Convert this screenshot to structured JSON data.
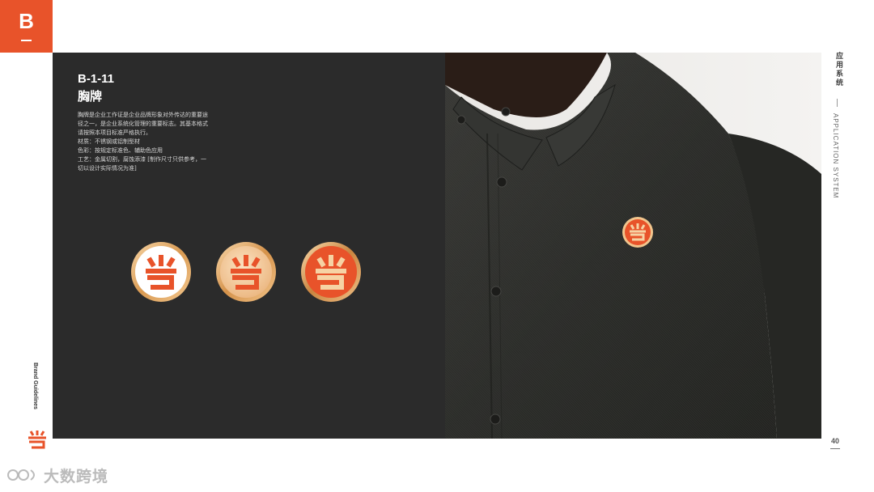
{
  "section": {
    "letter": "B"
  },
  "content": {
    "code": "B-1-11",
    "title": "胸牌",
    "description": [
      "胸牌是企业工作证是企业品牌形象对外传达的重要途径之一，是企业系统化管理的重要标志。其基本格式请按照本项目标准严格执行。",
      "材质：不锈钢或铝制型材",
      "色彩：按规定标准色、辅助色应用",
      "工艺：金属切割，腐蚀添漆 [制作尺寸只供参考，一切以设计实际情况为准]"
    ]
  },
  "badges": [
    {
      "variant": "white-face",
      "glyph": "sun-logo"
    },
    {
      "variant": "light-gold-face",
      "glyph": "sun-logo"
    },
    {
      "variant": "gold-face",
      "glyph": "sun-logo"
    }
  ],
  "side": {
    "category_cn": "应用系统",
    "category_en": "APPLICATION SYSTEM",
    "brand_guidelines": "Brand Guidelines"
  },
  "page_number": "40",
  "watermark": {
    "text": "大数跨境"
  },
  "colors": {
    "brand_orange": "#e8532a",
    "panel_dark": "#2b2b2b",
    "gold": "#e0a25a"
  }
}
